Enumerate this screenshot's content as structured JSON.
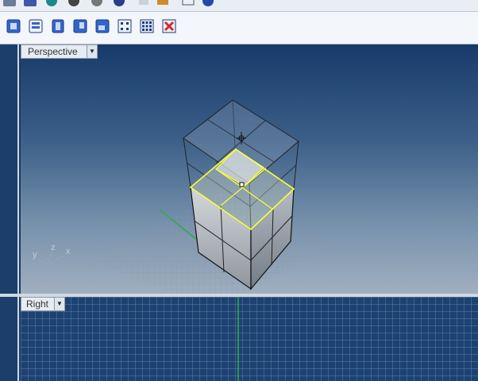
{
  "viewports": {
    "perspective": {
      "label": "Perspective"
    },
    "right": {
      "label": "Right"
    }
  },
  "axes": {
    "x": "x",
    "y": "y",
    "z": "z"
  },
  "toolbar_icons": [
    "top-view-icon",
    "cplane-view-icon",
    "front-view-icon",
    "right-view-icon",
    "bottom-view-icon",
    "grid-small-icon",
    "grid-large-icon",
    "close-viewport-icon"
  ],
  "colors": {
    "selection": "#ffff33",
    "grid_axis": "#33aa44",
    "viewport_bg": "#1c4272"
  }
}
